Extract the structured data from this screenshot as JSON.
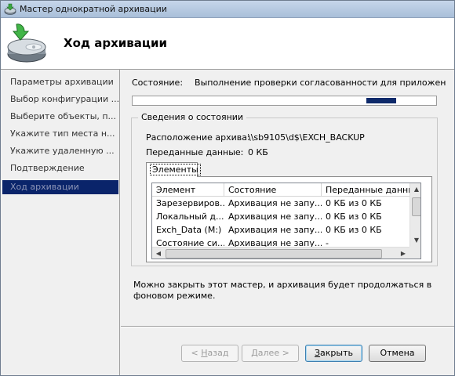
{
  "window": {
    "title": "Мастер однократной архивации"
  },
  "header": {
    "title": "Ход архивации",
    "icon": "backup-disk-icon"
  },
  "sidebar": {
    "items": [
      {
        "label": "Параметры архивации",
        "active": false
      },
      {
        "label": "Выбор конфигурации ...",
        "active": false
      },
      {
        "label": "Выберите объекты, п...",
        "active": false
      },
      {
        "label": "Укажите тип места н...",
        "active": false
      },
      {
        "label": "Укажите удаленную ...",
        "active": false
      },
      {
        "label": "Подтверждение",
        "active": false
      },
      {
        "label": "Ход архивации",
        "active": true
      }
    ]
  },
  "status": {
    "label": "Состояние:",
    "value": "Выполнение проверки согласованности для приложения Exch..."
  },
  "details": {
    "legend": "Сведения о состоянии",
    "location_label": "Расположение архива:",
    "location_value": "\\\\sb9105\\d$\\EXCH_BACKUP",
    "transferred_label": "Переданные данные:",
    "transferred_value": "0 КБ",
    "tab_label": "Элементы",
    "columns": [
      "Элемент",
      "Состояние",
      "Переданные данные"
    ],
    "rows": [
      [
        "Зарезервиров...",
        "Архивация не запу...",
        "0 КБ из 0 КБ"
      ],
      [
        "Локальный д...",
        "Архивация не запу...",
        "0 КБ из 0 КБ"
      ],
      [
        "Exch_Data (M:)",
        "Архивация не запу...",
        "0 КБ из 0 КБ"
      ],
      [
        "Состояние си...",
        "Архивация не запу...",
        "-"
      ]
    ]
  },
  "note": "Можно закрыть этот мастер, и архивация будет продолжаться в фоновом режиме.",
  "buttons": {
    "back": {
      "prefix": "< ",
      "accel": "Н",
      "rest": "азад"
    },
    "next": {
      "accel": "Д",
      "rest": "алее >"
    },
    "close": {
      "accel": "З",
      "rest": "акрыть"
    },
    "cancel": "Отмена"
  },
  "colors": {
    "active_item_bg": "#0a246a",
    "progress_chunk": "#0e2a6a"
  }
}
